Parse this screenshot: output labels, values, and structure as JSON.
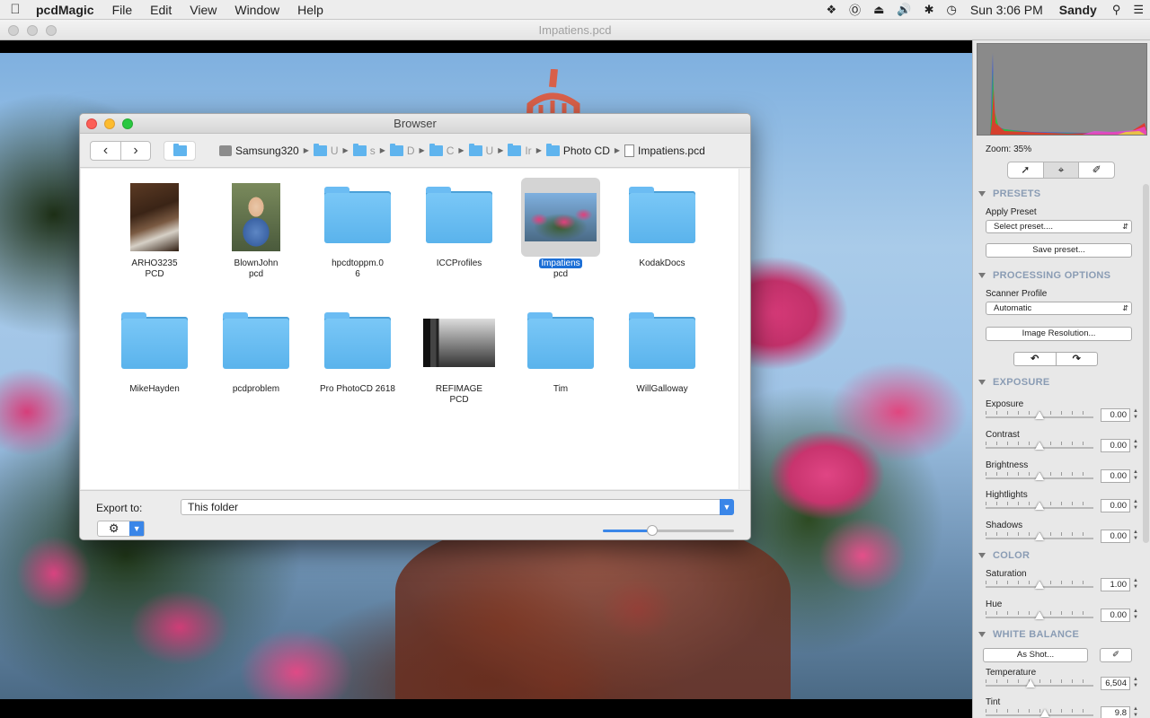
{
  "menubar": {
    "app": "pcdMagic",
    "items": [
      "File",
      "Edit",
      "View",
      "Window",
      "Help"
    ],
    "clock": "Sun 3:06 PM",
    "user": "Sandy"
  },
  "window": {
    "title": "Impatiens.pcd"
  },
  "browser": {
    "title": "Browser",
    "breadcrumbs": [
      {
        "label": "Samsung320",
        "kind": "disk"
      },
      {
        "label": "U",
        "kind": "folder"
      },
      {
        "label": "s",
        "kind": "folder"
      },
      {
        "label": "D",
        "kind": "folder"
      },
      {
        "label": "C",
        "kind": "folder"
      },
      {
        "label": "U",
        "kind": "folder"
      },
      {
        "label": "Ir",
        "kind": "folder"
      },
      {
        "label": "Photo CD",
        "kind": "folder"
      },
      {
        "label": "Impatiens.pcd",
        "kind": "file"
      }
    ],
    "items": [
      {
        "line1": "ARHO3235",
        "line2": "PCD",
        "kind": "thumb1"
      },
      {
        "line1": "BlownJohn",
        "line2": "pcd",
        "kind": "thumb2"
      },
      {
        "line1": "hpcdtoppm.0",
        "line2": "6",
        "kind": "folder"
      },
      {
        "line1": "ICCProfiles",
        "line2": "",
        "kind": "folder"
      },
      {
        "line1": "Impatiens",
        "line2": "pcd",
        "kind": "thumb3",
        "selected": true
      },
      {
        "line1": "KodakDocs",
        "line2": "",
        "kind": "folder"
      },
      {
        "line1": "MikeHayden",
        "line2": "",
        "kind": "folder"
      },
      {
        "line1": "pcdproblem",
        "line2": "",
        "kind": "folder"
      },
      {
        "line1": "Pro PhotoCD 2618",
        "line2": "",
        "kind": "folder"
      },
      {
        "line1": "REFIMAGE",
        "line2": "PCD",
        "kind": "thumb4"
      },
      {
        "line1": "Tim",
        "line2": "",
        "kind": "folder"
      },
      {
        "line1": "WillGalloway",
        "line2": "",
        "kind": "folder"
      }
    ],
    "export_label": "Export to:",
    "export_value": "This folder",
    "thumb_size_fraction": 0.38
  },
  "panel": {
    "zoom": "Zoom: 35%",
    "presets": {
      "header": "PRESETS",
      "apply_label": "Apply Preset",
      "select_value": "Select preset....",
      "save_button": "Save preset..."
    },
    "processing": {
      "header": "PROCESSING OPTIONS",
      "profile_label": "Scanner Profile",
      "profile_value": "Automatic",
      "resolution_button": "Image Resolution..."
    },
    "exposure": {
      "header": "EXPOSURE",
      "sliders": [
        {
          "label": "Exposure",
          "value": "0.00",
          "pos": 0.5
        },
        {
          "label": "Contrast",
          "value": "0.00",
          "pos": 0.5
        },
        {
          "label": "Brightness",
          "value": "0.00",
          "pos": 0.5
        },
        {
          "label": "Hightlights",
          "value": "0.00",
          "pos": 0.5
        },
        {
          "label": "Shadows",
          "value": "0.00",
          "pos": 0.5
        }
      ]
    },
    "color": {
      "header": "COLOR",
      "sliders": [
        {
          "label": "Saturation",
          "value": "1.00",
          "pos": 0.5
        },
        {
          "label": "Hue",
          "value": "0.00",
          "pos": 0.5
        }
      ]
    },
    "white_balance": {
      "header": "WHITE BALANCE",
      "as_shot_button": "As Shot...",
      "sliders": [
        {
          "label": "Temperature",
          "value": "6,504",
          "pos": 0.42
        },
        {
          "label": "Tint",
          "value": "9.8",
          "pos": 0.55
        }
      ]
    }
  },
  "colors": {
    "accent": "#3a86e8",
    "selection": "#1c6fd6",
    "folder": "#5ab3ec",
    "section_header": "#8a9cb4"
  }
}
